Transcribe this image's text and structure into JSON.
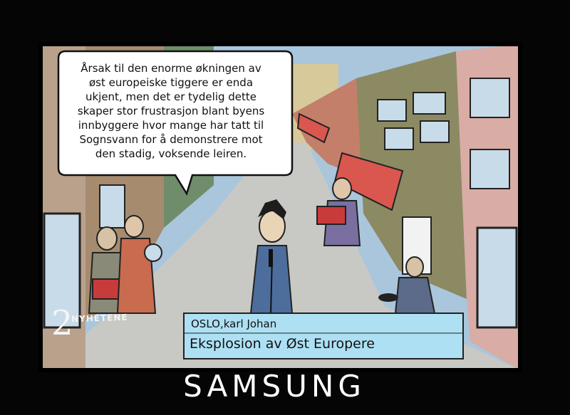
{
  "speech_bubble": {
    "lines": [
      "Årsak til den enorme økningen av",
      "øst europeiske tiggere er enda",
      "ukjent, men det er tydelig dette",
      "skaper stor frustrasjon blant byens",
      "innbyggere hvor mange har tatt til",
      "Sognsvann for å demonstrere mot",
      "den stadig, voksende leiren."
    ]
  },
  "channel": {
    "number": "2",
    "name": "NYHETENE"
  },
  "ticker": {
    "location": "OSLO,karl Johan",
    "headline": "Eksplosion av Øst Europere"
  },
  "tv_brand": "SAMSUNG",
  "colors": {
    "sky": "#a9c6dc",
    "street": "#c8c8c4",
    "awning": "#d9574e",
    "ticker": "#aee0f4",
    "frame": "#050505",
    "building_green": "#8c8a63"
  }
}
